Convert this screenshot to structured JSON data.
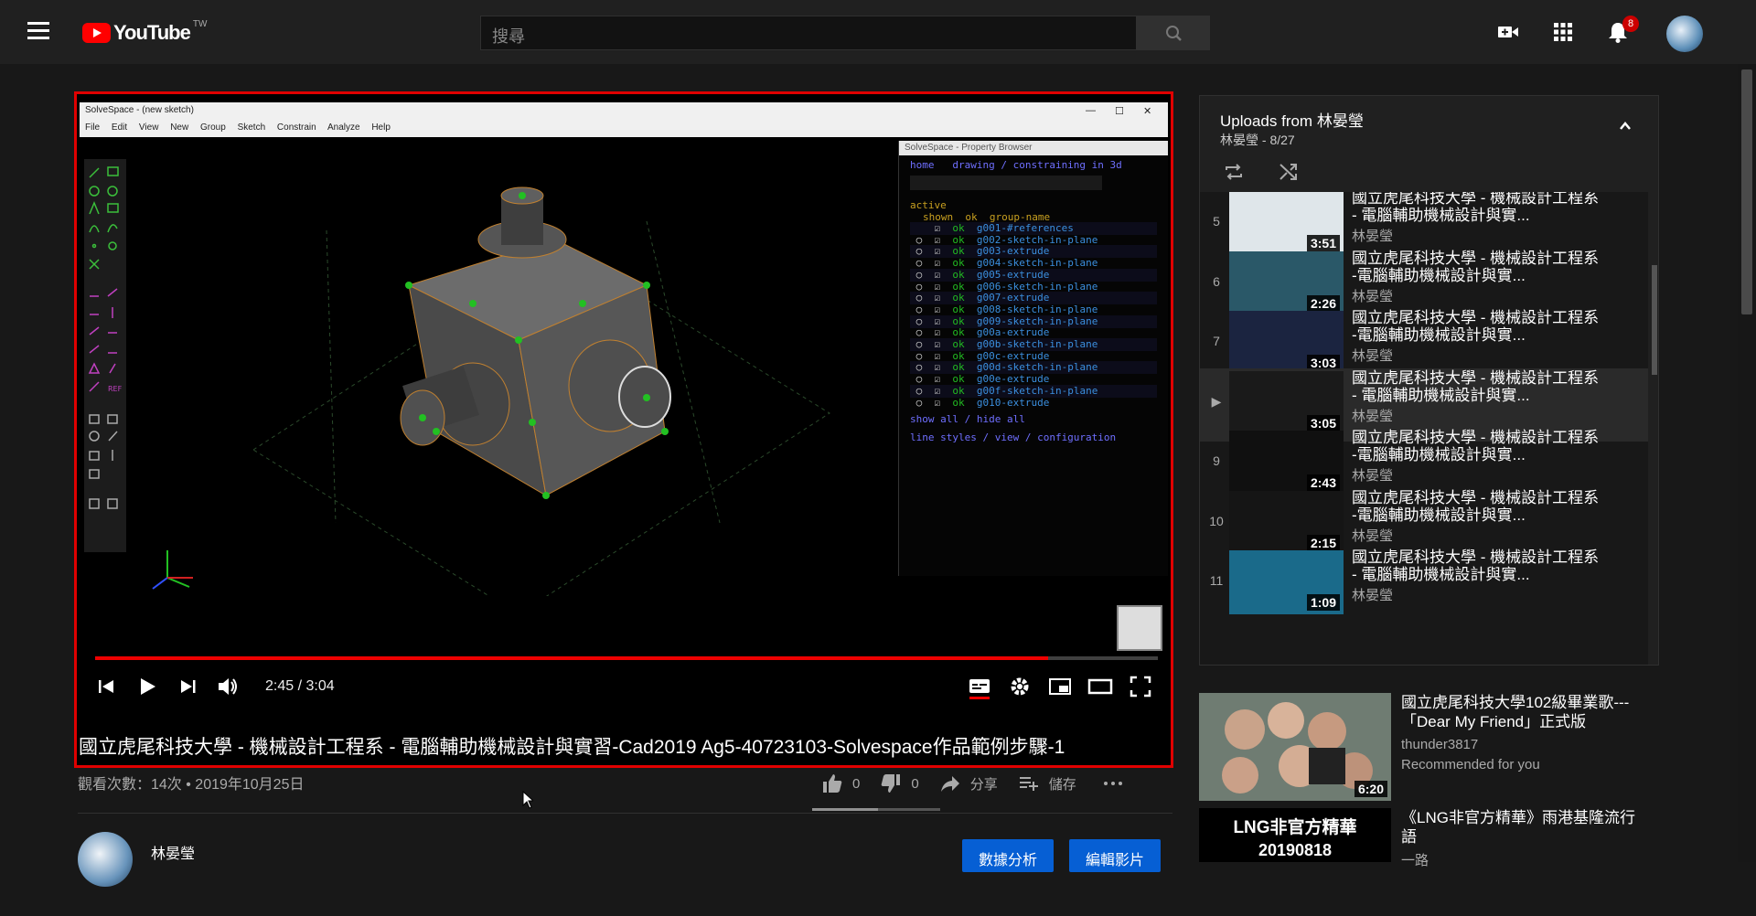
{
  "header": {
    "logo_text": "YouTube",
    "logo_region": "TW",
    "search_placeholder": "搜尋",
    "notification_count": "8"
  },
  "video": {
    "time_current": "2:45",
    "time_separator": " / ",
    "time_total": "3:04",
    "progress_fraction": 0.897,
    "title": "國立虎尾科技大學 - 機械設計工程系 - 電腦輔助機械設計與實習-Cad2019 Ag5-40723103-Solvespace作品範例步驟-1",
    "views_date": "觀看次數：14次 • 2019年10月25日"
  },
  "screen_content": {
    "window_title": "SolveSpace - (new sketch)",
    "menu": [
      "File",
      "Edit",
      "View",
      "New Group",
      "Sketch",
      "Constrain",
      "Analyze",
      "Help"
    ],
    "property_browser_title": "SolveSpace - Property Browser",
    "nav_line": "home   drawing / constraining in 3d",
    "active_label": "active",
    "columns": "shown  ok  group-name",
    "groups": [
      "g001-#references",
      "g002-sketch-in-plane",
      "g003-extrude",
      "g004-sketch-in-plane",
      "g005-extrude",
      "g006-sketch-in-plane",
      "g007-extrude",
      "g008-sketch-in-plane",
      "g009-sketch-in-plane",
      "g00a-extrude",
      "g00b-sketch-in-plane",
      "g00c-extrude",
      "g00d-sketch-in-plane",
      "g00e-extrude",
      "g00f-sketch-in-plane",
      "g010-extrude"
    ],
    "show_hide": "show all / hide all",
    "footer_links": "line styles / view / configuration"
  },
  "actions": {
    "like_count": "0",
    "dislike_count": "0",
    "share_label": "分享",
    "save_label": "儲存"
  },
  "channel": {
    "name": "林晏瑩",
    "analytics_button": "數據分析",
    "edit_button": "編輯影片"
  },
  "playlist": {
    "title_prefix": "Uploads from ",
    "title_channel": "林晏瑩",
    "subtitle": "林晏瑩 - 8/27",
    "items": [
      {
        "index": "5",
        "title": "國立虎尾科技大學 - 機械設計工程系 - 電腦輔助機械設計與實...",
        "channel": "林晏瑩",
        "duration": "3:51",
        "watched": 0
      },
      {
        "index": "6",
        "title": "國立虎尾科技大學 - 機械設計工程系 -電腦輔助機械設計與實...",
        "channel": "林晏瑩",
        "duration": "2:26",
        "watched": 0
      },
      {
        "index": "7",
        "title": "國立虎尾科技大學 - 機械設計工程系 -電腦輔助機械設計與實...",
        "channel": "林晏瑩",
        "duration": "3:03",
        "watched": 0
      },
      {
        "index": "▶",
        "title": "國立虎尾科技大學 - 機械設計工程系 - 電腦輔助機械設計與實...",
        "channel": "林晏瑩",
        "duration": "3:05",
        "watched": 0.2
      },
      {
        "index": "9",
        "title": "國立虎尾科技大學 - 機械設計工程系 -電腦輔助機械設計與實...",
        "channel": "林晏瑩",
        "duration": "2:43",
        "watched": 0.3
      },
      {
        "index": "10",
        "title": "國立虎尾科技大學 - 機械設計工程系 -電腦輔助機械設計與實...",
        "channel": "林晏瑩",
        "duration": "2:15",
        "watched": 0
      },
      {
        "index": "11",
        "title": "國立虎尾科技大學 - 機械設計工程系 - 電腦輔助機械設計與實...",
        "channel": "林晏瑩",
        "duration": "1:09",
        "watched": 0
      }
    ]
  },
  "recommendations": [
    {
      "title": "國立虎尾科技大學102級畢業歌---「Dear My Friend」正式版",
      "channel": "thunder3817",
      "note": "Recommended for you",
      "duration": "6:20"
    },
    {
      "title": "《LNG非官方精華》雨港基隆流行語",
      "channel": "一路",
      "thumb_text_1": "LNG非官方精華",
      "thumb_text_2": "20190818"
    }
  ],
  "colors": {
    "accent_red": "#ff0000",
    "button_blue": "#065fd4",
    "background": "#181818"
  }
}
